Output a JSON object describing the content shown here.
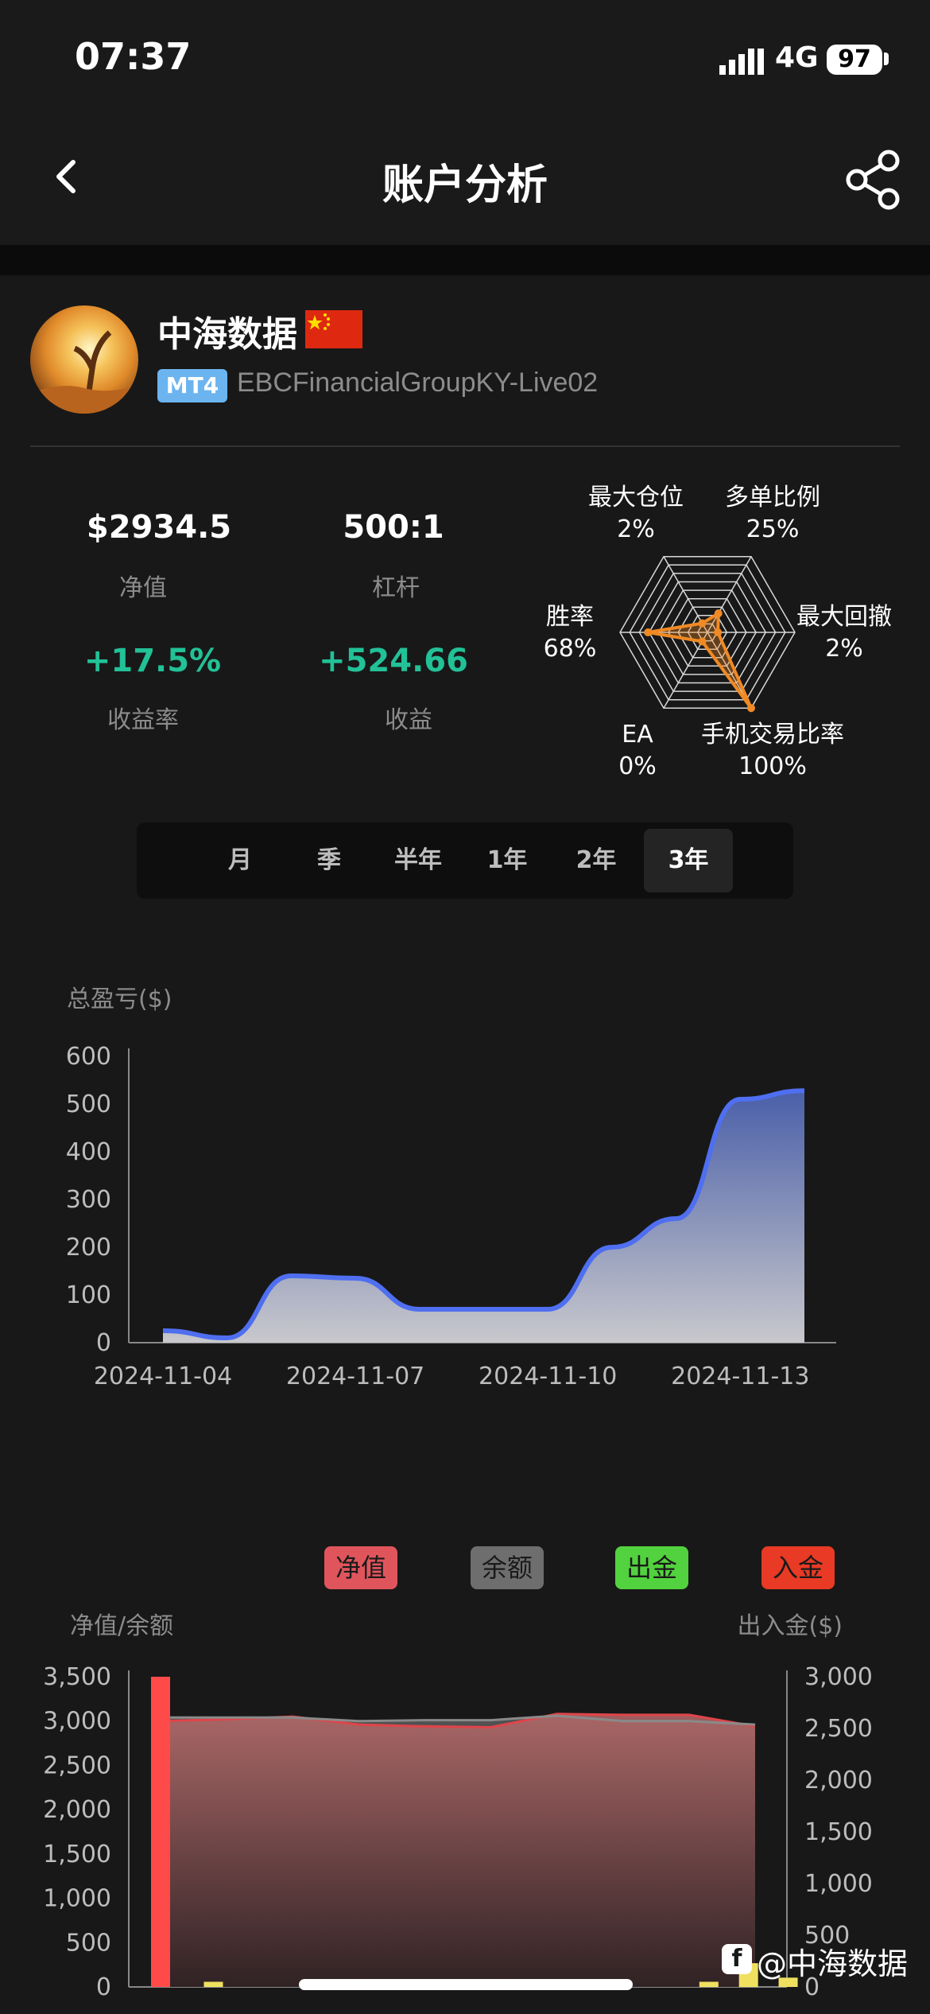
{
  "status_bar": {
    "time": "07:37",
    "network": "4G",
    "battery": "97"
  },
  "nav": {
    "title": "账户分析",
    "back_icon": "chevron-left-icon",
    "share_icon": "share-icon"
  },
  "profile": {
    "name": "中海数据",
    "flag": "cn-flag",
    "platform": "MT4",
    "account": "EBCFinancialGroupKY-Live02"
  },
  "stats": {
    "equity": {
      "value": "$2934.5",
      "label": "净值"
    },
    "leverage": {
      "value": "500:1",
      "label": "杠杆"
    },
    "yield": {
      "value": "+17.5%",
      "label": "收益率"
    },
    "profit": {
      "value": "+524.66",
      "label": "收益"
    }
  },
  "radar": {
    "axes": [
      {
        "name": "最大仓位",
        "value": "2%",
        "v": 0.02
      },
      {
        "name": "多单比例",
        "value": "25%",
        "v": 0.25
      },
      {
        "name": "最大回撤",
        "value": "2%",
        "v": 0.02
      },
      {
        "name": "手机交易比率",
        "value": "100%",
        "v": 1.0
      },
      {
        "name": "EA",
        "value": "0%",
        "v": 0.0
      },
      {
        "name": "胜率",
        "value": "68%",
        "v": 0.68
      }
    ],
    "color": "#f08a24"
  },
  "periods": [
    "月",
    "季",
    "半年",
    "1年",
    "2年",
    "3年"
  ],
  "active_period": "3年",
  "chart_data": [
    {
      "type": "area",
      "ylabel": "总盈亏($)",
      "ylim": [
        0,
        600
      ],
      "yticks": [
        "0",
        "100",
        "200",
        "300",
        "400",
        "500",
        "600"
      ],
      "xticks": [
        "2024-11-04",
        "2024-11-07",
        "2024-11-10",
        "2024-11-13"
      ],
      "x": [
        "2024-11-04",
        "2024-11-05",
        "2024-11-06",
        "2024-11-07",
        "2024-11-08",
        "2024-11-09",
        "2024-11-10",
        "2024-11-11",
        "2024-11-12",
        "2024-11-13",
        "2024-11-14"
      ],
      "series": [
        {
          "values": [
            25,
            10,
            140,
            135,
            70,
            70,
            70,
            200,
            260,
            510,
            528
          ]
        }
      ],
      "line_color": "#4f6ff0"
    },
    {
      "type": "bar+area",
      "left_label": "净值/余额",
      "right_label": "出入金($)",
      "ylim_left": [
        0,
        3500
      ],
      "ylim_right": [
        0,
        3000
      ],
      "yticks_left": [
        "0",
        "500",
        "1,000",
        "1,500",
        "2,000",
        "2,500",
        "3,000",
        "3,500"
      ],
      "yticks_right": [
        "0",
        "500",
        "1,000",
        "1,500",
        "2,000",
        "2,500",
        "3,000"
      ],
      "legend": [
        {
          "name": "净值",
          "color": "#e0555c"
        },
        {
          "name": "余额",
          "color": "#6e6e6e"
        },
        {
          "name": "出金",
          "color": "#52d23e"
        },
        {
          "name": "入金",
          "color": "#e83a24"
        }
      ],
      "series": [
        {
          "name": "净值",
          "values": [
            3000,
            3020,
            3050,
            2960,
            2940,
            2930,
            3080,
            3070,
            3070,
            2940
          ]
        },
        {
          "name": "余额",
          "values": [
            3040,
            3040,
            3040,
            3000,
            3010,
            3010,
            3060,
            3000,
            3000,
            2960
          ]
        }
      ],
      "bars": [
        {
          "x": 0,
          "value": 3000,
          "color": "#ff4a4a"
        },
        {
          "x": 0.8,
          "value": 50,
          "color": "#f0e060"
        },
        {
          "x": 8.3,
          "value": 50,
          "color": "#f0e060"
        },
        {
          "x": 8.9,
          "value": 230,
          "color": "#f0e060"
        },
        {
          "x": 9.5,
          "value": 90,
          "color": "#f0e060"
        }
      ]
    }
  ],
  "watermark": "@中海数据"
}
